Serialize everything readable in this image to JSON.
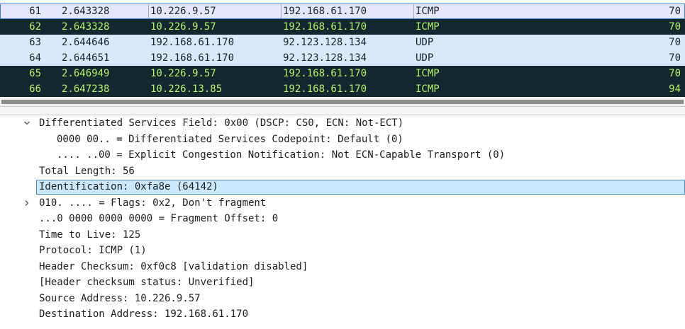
{
  "packets": [
    {
      "no": "61",
      "time": "2.643328",
      "src": "10.226.9.57",
      "dst": "192.168.61.170",
      "proto": "ICMP",
      "len": "70",
      "bg": "#e7e6ff",
      "fg": "#12272e",
      "state": "selected"
    },
    {
      "no": "62",
      "time": "2.643328",
      "src": "10.226.9.57",
      "dst": "192.168.61.170",
      "proto": "ICMP",
      "len": "70",
      "bg": "#12272e",
      "fg": "#b6f26c",
      "state": "normal"
    },
    {
      "no": "63",
      "time": "2.644646",
      "src": "192.168.61.170",
      "dst": "92.123.128.134",
      "proto": "UDP",
      "len": "70",
      "bg": "#dae8fc",
      "fg": "#12272e",
      "state": "normal"
    },
    {
      "no": "64",
      "time": "2.644651",
      "src": "192.168.61.170",
      "dst": "92.123.128.134",
      "proto": "UDP",
      "len": "70",
      "bg": "#dae8fc",
      "fg": "#12272e",
      "state": "normal"
    },
    {
      "no": "65",
      "time": "2.646949",
      "src": "10.226.9.57",
      "dst": "192.168.61.170",
      "proto": "ICMP",
      "len": "70",
      "bg": "#12272e",
      "fg": "#b6f26c",
      "state": "normal"
    },
    {
      "no": "66",
      "time": "2.647238",
      "src": "10.226.13.85",
      "dst": "192.168.61.170",
      "proto": "ICMP",
      "len": "94",
      "bg": "#12272e",
      "fg": "#b6f26c",
      "state": "normal"
    }
  ],
  "details": [
    {
      "text": "Differentiated Services Field: 0x00 (DSCP: CS0, ECN: Not-ECT)",
      "indent": 1,
      "expander": "expanded"
    },
    {
      "text": "0000 00.. = Differentiated Services Codepoint: Default (0)",
      "indent": 2,
      "expander": "none"
    },
    {
      "text": ".... ..00 = Explicit Congestion Notification: Not ECN-Capable Transport (0)",
      "indent": 2,
      "expander": "none"
    },
    {
      "text": "Total Length: 56",
      "indent": 1,
      "expander": "none"
    },
    {
      "text": "Identification: 0xfa8e (64142)",
      "indent": 1,
      "expander": "none",
      "selected": true
    },
    {
      "text": "010. .... = Flags: 0x2, Don't fragment",
      "indent": 1,
      "expander": "collapsed"
    },
    {
      "text": "...0 0000 0000 0000 = Fragment Offset: 0",
      "indent": 1,
      "expander": "none"
    },
    {
      "text": "Time to Live: 125",
      "indent": 1,
      "expander": "none"
    },
    {
      "text": "Protocol: ICMP (1)",
      "indent": 1,
      "expander": "none"
    },
    {
      "text": "Header Checksum: 0xf0c8 [validation disabled]",
      "indent": 1,
      "expander": "none"
    },
    {
      "text": "[Header checksum status: Unverified]",
      "indent": 1,
      "expander": "none"
    },
    {
      "text": "Source Address: 10.226.9.57",
      "indent": 1,
      "expander": "none"
    },
    {
      "text": "Destination Address: 192.168.61.170",
      "indent": 1,
      "expander": "none"
    }
  ],
  "colors": {
    "selection_fill": "#cce8ff",
    "selection_border": "#4a88c7",
    "icmp_bg": "#12272e",
    "icmp_fg": "#b6f26c",
    "udp_bg": "#dae8fc"
  }
}
